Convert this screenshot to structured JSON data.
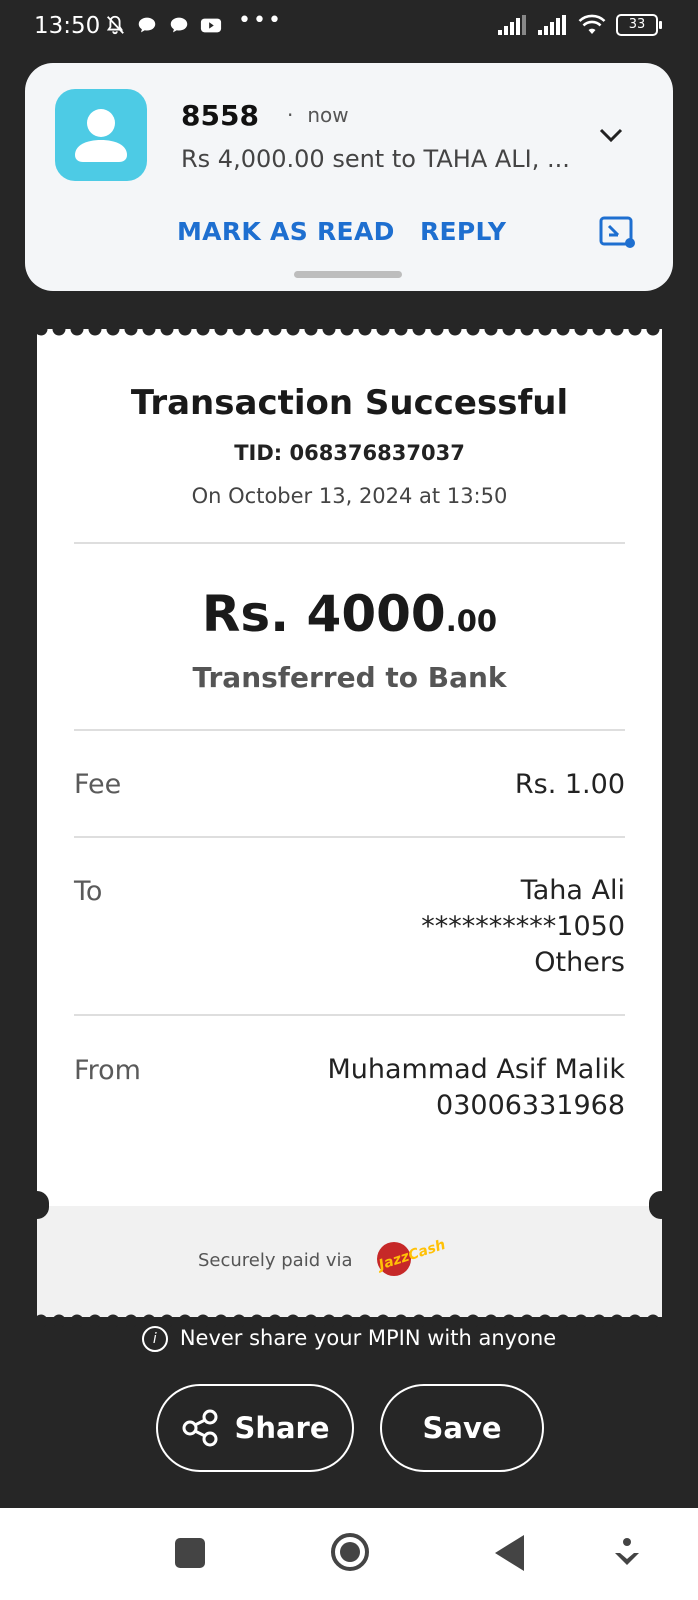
{
  "status_bar": {
    "time": "13:50",
    "battery": "33",
    "icons": [
      "mute-bell-icon",
      "chat-icon",
      "chat-icon",
      "youtube-icon",
      "more-dots-icon",
      "signal-icon",
      "signal-icon",
      "wifi-icon",
      "battery-icon"
    ]
  },
  "notification": {
    "sender": "8558",
    "time": "now",
    "message": "Rs 4,000.00 sent to TAHA ALI, ...",
    "mark_read_label": "MARK AS READ",
    "reply_label": "REPLY",
    "accent_color": "#1e6fd0",
    "avatar_color": "#4dcbe5"
  },
  "receipt": {
    "title": "Transaction Successful",
    "tid": "TID: 068376837037",
    "date": "On October 13, 2024 at 13:50",
    "amount_main": "Rs. 4000",
    "amount_decimal": ".00",
    "transfer_type": "Transferred to Bank",
    "fee_label": "Fee",
    "fee_value": "Rs. 1.00",
    "to_label": "To",
    "to_name": "Taha Ali",
    "to_account": "**********1050",
    "to_bank": "Others",
    "from_label": "From",
    "from_name": "Muhammad Asif Malik",
    "from_number": "03006331968",
    "secure_text": "Securely paid via",
    "brand": "JazzCash"
  },
  "warning": "Never share your MPIN with anyone",
  "actions": {
    "share_label": "Share",
    "save_label": "Save"
  }
}
